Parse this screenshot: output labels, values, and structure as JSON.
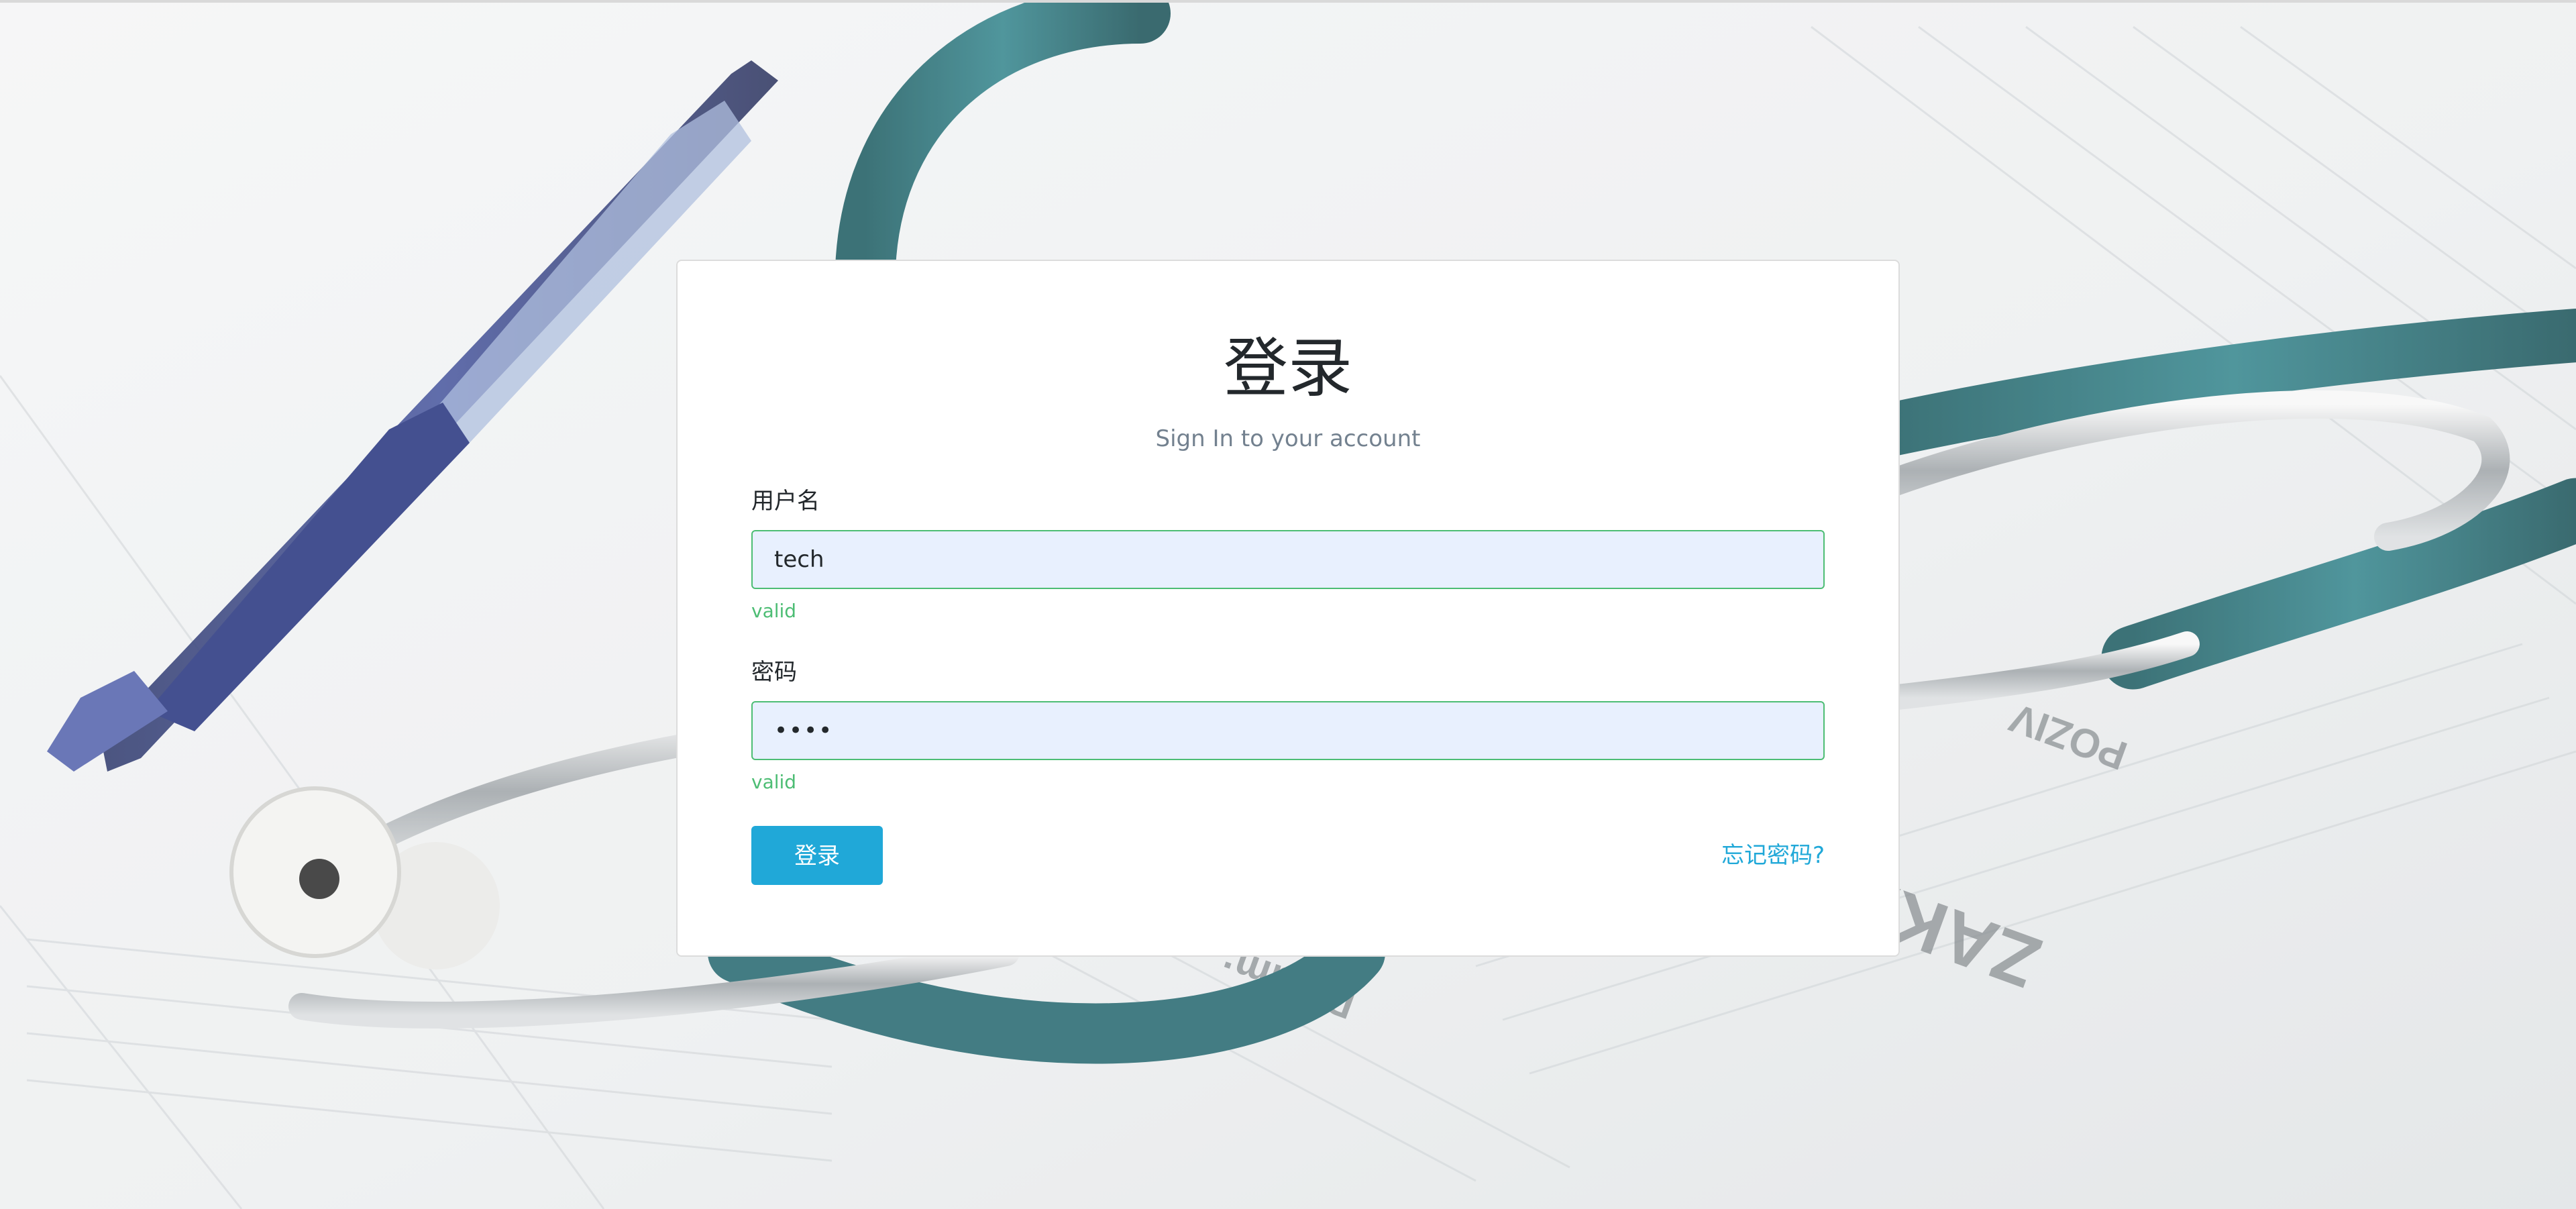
{
  "login": {
    "title": "登录",
    "subtitle": "Sign In to your account",
    "username": {
      "label": "用户名",
      "value": "tech",
      "validation": "valid"
    },
    "password": {
      "label": "密码",
      "value": "••••",
      "validation": "valid"
    },
    "submit_label": "登录",
    "forgot_label": "忘记密码?"
  },
  "colors": {
    "accent": "#20a8d8",
    "valid": "#4dbd74",
    "input_bg": "#e8f0fe",
    "card_bg": "#ffffff",
    "stethoscope": "#1f6a71",
    "pen": "#1f2f7a"
  },
  "icons": {
    "background": "medical-stethoscope-photo"
  }
}
